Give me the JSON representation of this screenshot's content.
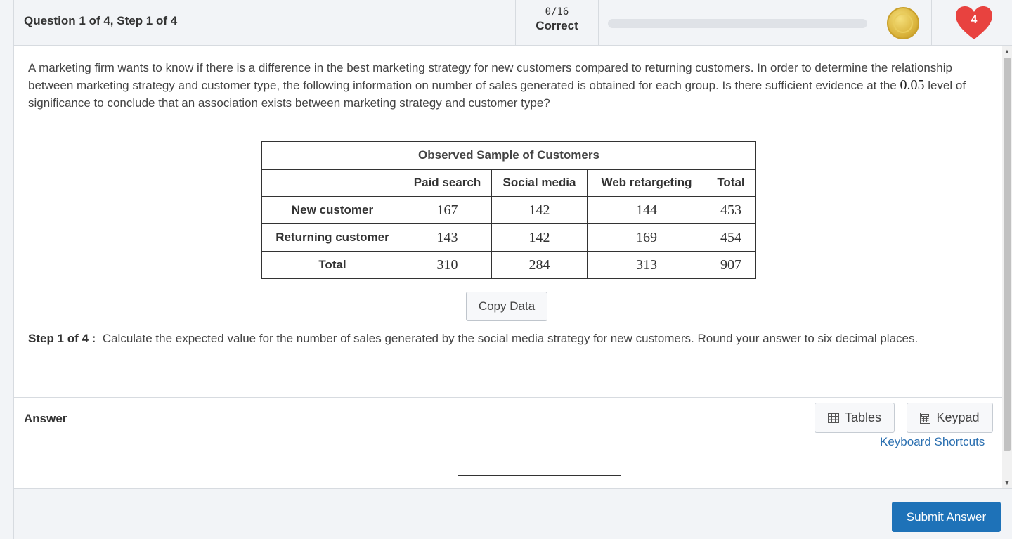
{
  "header": {
    "question_label": "Question 1 of 4, Step 1 of 4",
    "score": "0/16",
    "score_label": "Correct",
    "progress": 0,
    "hearts": "4"
  },
  "question": {
    "text_before": "A marketing firm wants to know if there is a difference in the best marketing strategy for new customers compared to returning customers. In order to determine the relationship between marketing strategy and customer type, the following information on number of sales generated is obtained for each group. Is there sufficient evidence at the ",
    "significance": "0.05",
    "text_after": " level of significance to conclude that an association exists between marketing strategy and customer type?"
  },
  "table": {
    "caption": "Observed Sample of Customers",
    "columns": [
      "",
      "Paid search",
      "Social media",
      "Web retargeting",
      "Total"
    ],
    "rows": [
      {
        "label": "New customer",
        "values": [
          "167",
          "142",
          "144",
          "453"
        ]
      },
      {
        "label": "Returning customer",
        "values": [
          "143",
          "142",
          "169",
          "454"
        ]
      },
      {
        "label": "Total",
        "values": [
          "310",
          "284",
          "313",
          "907"
        ]
      }
    ]
  },
  "copy_data_label": "Copy Data",
  "step": {
    "label": "Step 1 of 4 :",
    "text": "Calculate the expected value for the number of sales generated by the social media strategy for new customers. Round your answer to six decimal places."
  },
  "answer": {
    "label": "Answer",
    "tables_label": "Tables",
    "keypad_label": "Keypad",
    "shortcuts_label": "Keyboard Shortcuts"
  },
  "footer": {
    "submit_label": "Submit Answer"
  },
  "colors": {
    "accent": "#1e72b8",
    "heart": "#e8423f",
    "link": "#2a6fb0"
  }
}
